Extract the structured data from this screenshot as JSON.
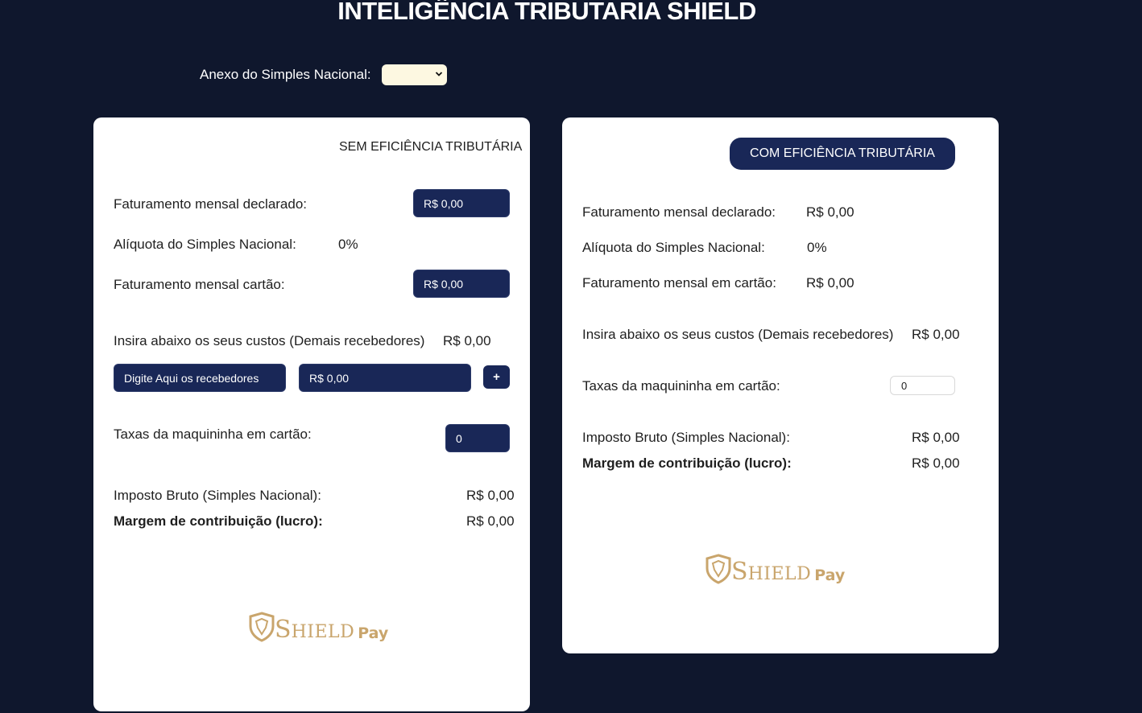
{
  "header": {
    "title": "INTELIGÊNCIA TRIBUTARIA SHIELD",
    "anexo_label": "Anexo do Simples Nacional:",
    "anexo_selected": ""
  },
  "left": {
    "title": "SEM EFICIÊNCIA TRIBUTÁRIA",
    "fat_declarado_label": "Faturamento mensal declarado:",
    "fat_declarado_value": "R$ 0,00",
    "aliquota_label": "Alíquota do Simples Nacional:",
    "aliquota_value": "0%",
    "fat_cartao_label": "Faturamento mensal cartão:",
    "fat_cartao_value": "R$ 0,00",
    "custos_label": "Insira abaixo os seus custos (Demais recebedores)",
    "custos_total": "R$ 0,00",
    "recebedor_placeholder": "Digite Aqui os recebedores",
    "recebedor_valor": "R$ 0,00",
    "add_label": "+",
    "taxas_label": "Taxas da maquininha em cartão:",
    "taxas_value": "0",
    "imposto_label": "Imposto Bruto (Simples Nacional):",
    "imposto_value": "R$ 0,00",
    "margem_label": "Margem de contribuição (lucro):",
    "margem_value": "R$ 0,00"
  },
  "right": {
    "title": "COM EFICIÊNCIA TRIBUTÁRIA",
    "fat_declarado_label": "Faturamento mensal declarado:",
    "fat_declarado_value": "R$ 0,00",
    "aliquota_label": "Alíquota do Simples Nacional:",
    "aliquota_value": "0%",
    "fat_cartao_label": "Faturamento mensal em cartão:",
    "fat_cartao_value": "R$ 0,00",
    "custos_label": "Insira abaixo os seus custos (Demais recebedores)",
    "custos_total": "R$ 0,00",
    "taxas_label": "Taxas da maquininha em cartão:",
    "taxas_value": "0",
    "imposto_label": "Imposto Bruto (Simples Nacional):",
    "imposto_value": "R$ 0,00",
    "margem_label": "Margem de contribuição (lucro):",
    "margem_value": "R$ 0,00"
  },
  "logo": {
    "s": "S",
    "rest": "HIELD",
    "pay": "Pay",
    "color": "#c9a56c"
  },
  "colors": {
    "background": "#0f172d",
    "navy": "#192757",
    "card": "#ffffff"
  }
}
